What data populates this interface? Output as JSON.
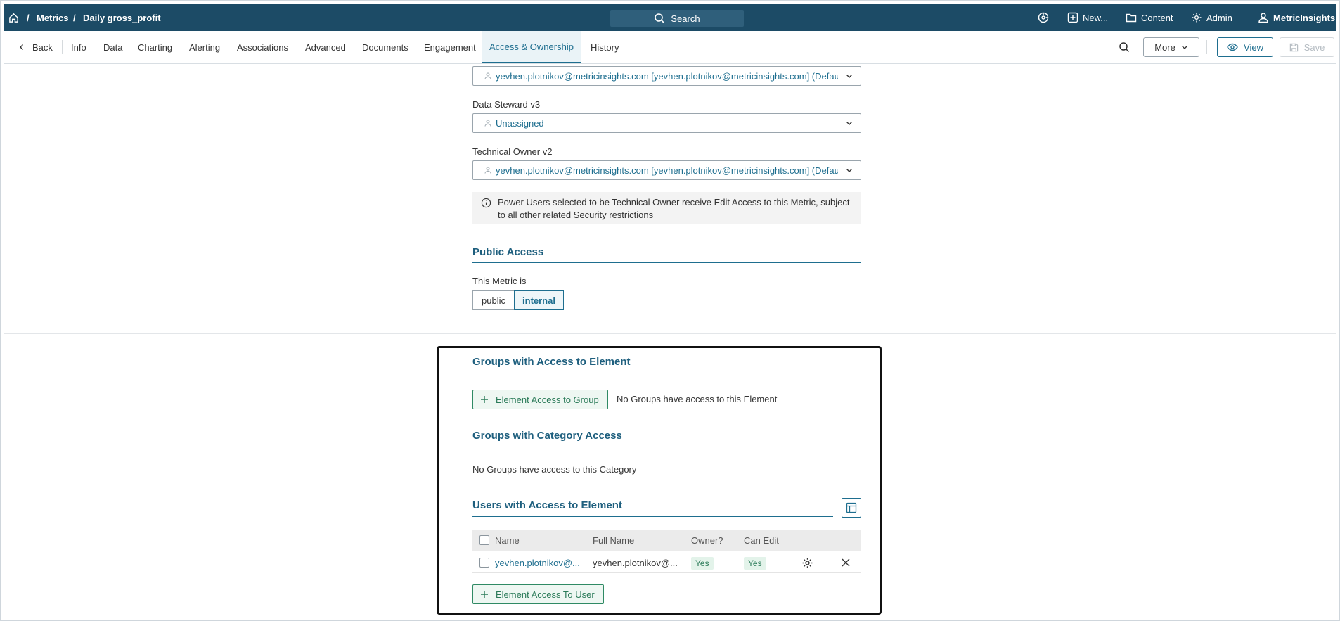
{
  "topbar": {
    "breadcrumb": [
      "Metrics",
      "Daily gross_profit"
    ],
    "search_label": "Search",
    "new_label": "New...",
    "content_label": "Content",
    "admin_label": "Admin",
    "user_label": "MetricInsights"
  },
  "tabs": {
    "back_label": "Back",
    "items": [
      "Info",
      "Data",
      "Charting",
      "Alerting",
      "Associations",
      "Advanced",
      "Documents",
      "Engagement",
      "Access & Ownership",
      "History"
    ],
    "active": "Access & Ownership",
    "more_label": "More",
    "view_label": "View",
    "save_label": "Save"
  },
  "ownership": {
    "owner_value": "yevhen.plotnikov@metricinsights.com [yevhen.plotnikov@metricinsights.com] (Default)",
    "data_steward_label": "Data Steward v3",
    "data_steward_value": "Unassigned",
    "technical_owner_label": "Technical Owner v2",
    "technical_owner_value": "yevhen.plotnikov@metricinsights.com [yevhen.plotnikov@metricinsights.com] (Default)",
    "info_text": "Power Users selected to be Technical Owner receive Edit Access to this Metric, subject to all other related Security restrictions"
  },
  "public_access": {
    "title": "Public Access",
    "label": "This Metric is",
    "options": [
      "public",
      "internal"
    ],
    "selected": "internal"
  },
  "groups_element": {
    "title": "Groups with Access to Element",
    "button_label": "Element Access to Group",
    "empty_text": "No Groups have access to this Element"
  },
  "groups_category": {
    "title": "Groups with Category Access",
    "empty_text": "No Groups have access to this Category"
  },
  "users_element": {
    "title": "Users with Access to Element",
    "columns": [
      "Name",
      "Full Name",
      "Owner?",
      "Can Edit"
    ],
    "rows": [
      {
        "name": "yevhen.plotnikov@...",
        "full_name": "yevhen.plotnikov@...",
        "owner": "Yes",
        "can_edit": "Yes"
      }
    ],
    "button_label": "Element Access To User"
  },
  "colors": {
    "topbar": "#1c4b66",
    "accent": "#1e6e8f",
    "green": "#2a7a58"
  }
}
